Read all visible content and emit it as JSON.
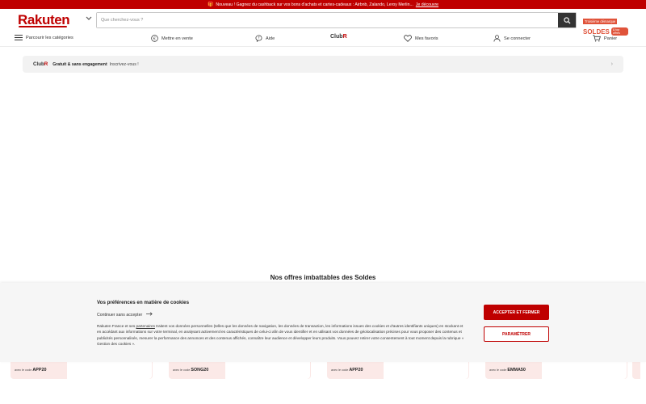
{
  "top_banner": {
    "text": "Nouveau ! Gagnez du cashback sur vos bons d'achats et cartes-cadeaux : Airbnb, Zalando, Leroy Merlin...",
    "link": "Je découvre"
  },
  "header": {
    "logo": "Rakuten",
    "search_placeholder": "Que cherchez-vous ?",
    "promo_line1": "Troisième démarque",
    "promo_title": "SOLDES",
    "promo_badge": "& top offres"
  },
  "nav": {
    "categories": "Parcourir les catégories",
    "sell": "Mettre en vente",
    "help": "Aide",
    "club_prefix": "Club",
    "club_suffix": "R",
    "favorites": "Mes favoris",
    "login": "Se connecter",
    "cart": "Panier"
  },
  "club_bar": {
    "club_prefix": "Club",
    "club_suffix": "R",
    "bold_text": "Gratuit & sans engagement",
    "text": "Inscrivez-vous !"
  },
  "section_title": "Nos offres imbattables des Soldes",
  "cards": [
    {
      "label": "avec le code",
      "code": "APP20"
    },
    {
      "label": "avec le code",
      "code": "SONG20"
    },
    {
      "label": "avec le code",
      "code": "APP20"
    },
    {
      "label": "avec le code",
      "code": "EMMA50"
    }
  ],
  "cookie": {
    "title": "Vos préférences en matière de cookies",
    "continue": "Continuer sans accepter",
    "text_before": "Rakuten France et ses ",
    "text_link": "partenaires",
    "text_after": " traitent vos données personnelles (telles que les données de navigation, les données de transaction, les informations issues des cookies et d'autres identifiants uniques) en stockant et en accédant aux informations sur votre terminal, en analysant activement les caractéristiques de celui-ci afin de vous identifier et en utilisant vos données de géolocalisation précises pour vous proposer des contenus et publicités personnalisés, mesurer la performance des annonces et des contenus affichés, connaître leur audience et développer leurs produits. Vous pouvez retirer votre consentement à tout moment depuis la rubrique « Gestion des cookies ».",
    "accept": "ACCEPTER ET FERMER",
    "settings": "PARAMÉTRER"
  },
  "colors": {
    "brand_red": "#bf0000",
    "promo_orange": "#e0533a",
    "card_bg": "#fbe9e7"
  },
  "icons": [
    "gift-icon",
    "chevron-down-icon",
    "search-icon",
    "menu-icon",
    "euro-icon",
    "help-bubble-icon",
    "heart-icon",
    "user-icon",
    "cart-icon",
    "arrow-right-icon",
    "chevron-right-icon"
  ]
}
